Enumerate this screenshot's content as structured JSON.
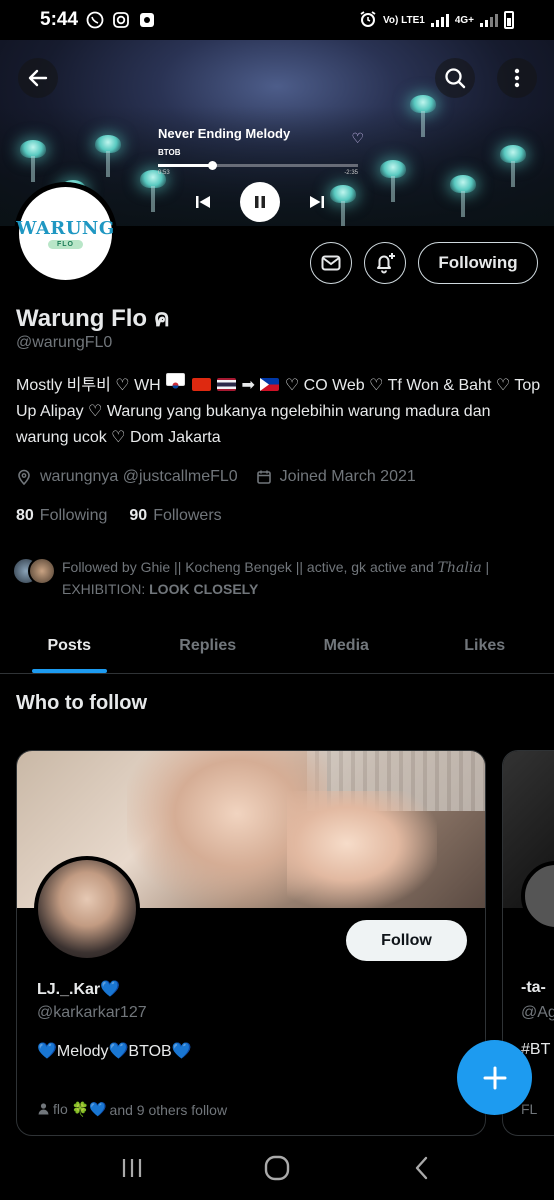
{
  "status_bar": {
    "time": "5:44",
    "network_label": "Vo) LTE1",
    "network2_label": "4G+"
  },
  "player": {
    "song": "Never Ending Melody",
    "artist": "BTOB",
    "elapsed": "0:53",
    "remaining": "-2:35",
    "progress_fraction": 0.27
  },
  "profile": {
    "logo_text": "WARUNG",
    "logo_subtext": "FLO",
    "following_label": "Following",
    "name": "Warung Flo ค",
    "handle": "@warungFL0",
    "bio_part1": "Mostly 비투비 ♡ WH",
    "bio_part2": "♡ CO Web ♡ Tf Won & Baht ♡ Top Up Alipay ♡ Warung yang bukanya ngelebihin warung madura dan warung ucok ♡ Dom Jakarta",
    "soon_arrow": "➡",
    "location": "warungnya @justcallmeFL0",
    "joined": "Joined March 2021",
    "following_count": "80",
    "following_text": "Following",
    "followers_count": "90",
    "followers_text": "Followers",
    "followed_by_text": "Followed by Ghie || Kocheng Bengek || active, gk active and ",
    "followed_by_name2": "Thalia",
    "followed_by_rest": " | EXHIBITION: ",
    "followed_by_bold": "LOOK CLOSELY"
  },
  "tabs": [
    {
      "label": "Posts",
      "active": true
    },
    {
      "label": "Replies",
      "active": false
    },
    {
      "label": "Media",
      "active": false
    },
    {
      "label": "Likes",
      "active": false
    }
  ],
  "who_to_follow": {
    "title": "Who to follow",
    "card1": {
      "name": "LJ._.Kar💙",
      "handle": "@karkarkar127",
      "bio": "💙Melody💙BTOB💙",
      "follow_label": "Follow",
      "footer_name": "flo 🍀💙",
      "footer_rest": " and 9 others follow"
    },
    "card2": {
      "name": "-ta-",
      "handle": "@Ag",
      "bio": "#BT",
      "footer": "FL"
    }
  },
  "colors": {
    "accent": "#1d9bf0",
    "text_primary": "#e7e9ea",
    "text_secondary": "#71767b",
    "background": "#000000",
    "border": "#2f3336"
  }
}
